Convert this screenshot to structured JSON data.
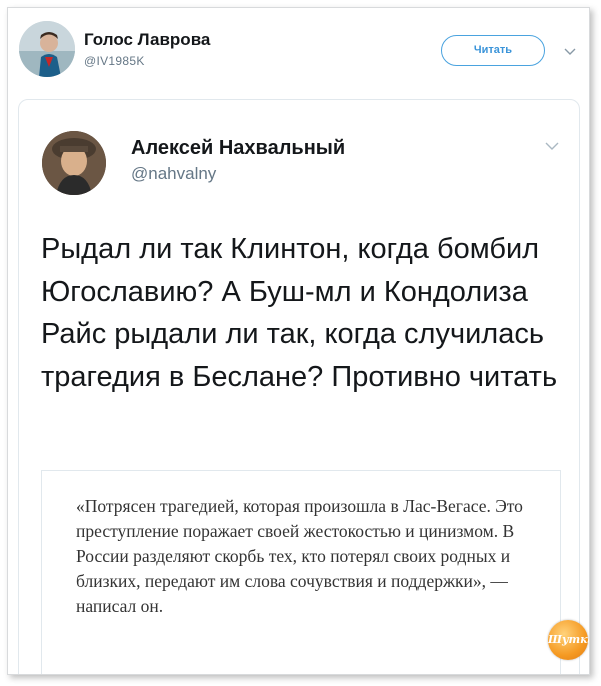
{
  "outer_tweet": {
    "author_name": "Голос Лаврова",
    "author_handle": "@IV1985K",
    "follow_label": "Читать"
  },
  "quoted_tweet": {
    "author_name": "Алексей Нахвальный",
    "author_handle": "@nahvalny",
    "text": "Рыдал ли так Клинтон, когда бомбил Югославию? А Буш-мл и Кондолиза Райс рыдали ли так, когда случилась трагедия в Беслане? Противно читать",
    "quote": "«Потрясен трагедией, которая произошла в Лас-Вегасе. Это преступление поражает своей жестокостью и цинизмом. В России разделяют скорбь тех, кто потерял своих родных и близких, передают им слова сочувствия и поддержки», — написал он."
  },
  "watermark": {
    "text": "Шутка"
  },
  "colors": {
    "accent": "#3b94d9",
    "border": "#e1e8ed",
    "text": "#14171a",
    "muted": "#657786"
  },
  "icons": [
    "chevron-down-icon"
  ]
}
